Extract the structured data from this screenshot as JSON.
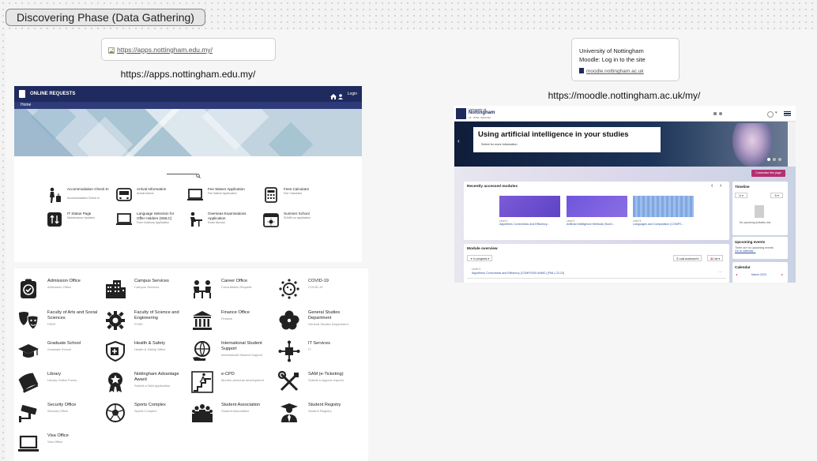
{
  "section": {
    "title": "Discovering Phase (Data Gathering)"
  },
  "left_link": {
    "url_text": "https://apps.nottingham.edu.my/",
    "caption": "https://apps.nottingham.edu.my/"
  },
  "right_link": {
    "title_line1": "University of Nottingham",
    "title_line2": "Moodle: Log in to the site",
    "domain": "moodle.nottingham.ac.uk",
    "caption": "https://moodle.nottingham.ac.uk/my/"
  },
  "online_requests": {
    "header": "ONLINE REQUESTS",
    "login": "Login",
    "nav_home": "Home",
    "tiles": [
      {
        "title": "Accommodation Check-In",
        "sub": "Accommodation Check In"
      },
      {
        "title": "Arrival Information",
        "sub": "Arrival Advice"
      },
      {
        "title": "Fee Waiver Application",
        "sub": "Fee Waiver Application"
      },
      {
        "title": "Fees Calculator",
        "sub": "Fee Calculator"
      },
      {
        "title": "IT Status Page",
        "sub": "Maintenance Updates"
      },
      {
        "title": "Language Selection for Offer Holders (SMLC)",
        "sub": "Form Advisory Application"
      },
      {
        "title": "Overseas Examinations Application",
        "sub": "Exam Abroad"
      },
      {
        "title": "Summer School",
        "sub": "SUMM on application"
      }
    ]
  },
  "directory": {
    "items": [
      {
        "title": "Admission Office",
        "sub": "Admission Office",
        "icon": "clipboard-check-icon"
      },
      {
        "title": "Campus Services",
        "sub": "Campus Services",
        "icon": "buildings-icon"
      },
      {
        "title": "Career Office",
        "sub": "Consultation Request",
        "icon": "meeting-icon"
      },
      {
        "title": "COVID-19",
        "sub": "COVID-19",
        "icon": "virus-icon"
      },
      {
        "title": "Faculty of Arts and Social Sciences",
        "sub": "FASS",
        "icon": "theater-masks-icon"
      },
      {
        "title": "Faculty of Science and Engineering",
        "sub": "FOSE",
        "icon": "gear-icon"
      },
      {
        "title": "Finance Office",
        "sub": "Finance",
        "icon": "bank-icon"
      },
      {
        "title": "General Studies Department",
        "sub": "General Studies Department",
        "icon": "flower-icon"
      },
      {
        "title": "Graduate School",
        "sub": "Graduate School",
        "icon": "graduation-cap-icon"
      },
      {
        "title": "Health & Safety",
        "sub": "Health & Safety Office",
        "icon": "medical-shield-icon"
      },
      {
        "title": "International Student Support",
        "sub": "International Student Support",
        "icon": "globe-hand-icon"
      },
      {
        "title": "IT Services",
        "sub": "IT",
        "icon": "network-icon"
      },
      {
        "title": "Library",
        "sub": "Library Online Forms",
        "icon": "book-icon"
      },
      {
        "title": "Nottingham Advantage Award",
        "sub": "Submit a NAA application",
        "icon": "award-icon"
      },
      {
        "title": "e-CPD",
        "sub": "Monitor personal development",
        "icon": "stairs-climb-icon"
      },
      {
        "title": "SAM (e-Ticketing)",
        "sub": "Submit a support request",
        "icon": "tools-icon"
      },
      {
        "title": "Security Office",
        "sub": "Security Office",
        "icon": "cctv-icon"
      },
      {
        "title": "Sports Complex",
        "sub": "Sports Complex",
        "icon": "soccer-ball-icon"
      },
      {
        "title": "Student Association",
        "sub": "Student Association",
        "icon": "group-icon"
      },
      {
        "title": "Student Registry",
        "sub": "Student Registry",
        "icon": "graduate-person-icon"
      },
      {
        "title": "Visa Office",
        "sub": "Visa Office",
        "icon": "laptop-icon"
      }
    ]
  },
  "moodle": {
    "logo_line1": "University of",
    "logo_line2": "Nottingham",
    "logo_line3": "UK · CHINA · MALAYSIA",
    "hero_title": "Using artificial intelligence in your studies",
    "hero_sub": "Select for more information",
    "customise": "Customise this page",
    "recent_title": "Recently accessed modules",
    "modules": [
      {
        "level": "Level 3",
        "name": "Algorithms Correctness and Efficiency..."
      },
      {
        "level": "Level 3",
        "name": "Artificial Intelligence Methods (Sum2..."
      },
      {
        "level": "Level 3",
        "name": "Languages and Computation (COMP2..."
      }
    ],
    "overview_title": "Module overview",
    "filter_label": "In progress",
    "sort_label": "Last accessed",
    "view_label": "List",
    "overview_level": "Level 3",
    "overview_item": "Algorithms Correctness and Efficiency (COMP2039 UNMC) (FML1 22-23)",
    "timeline_title": "Timeline",
    "timeline_empty": "No upcoming activities due",
    "events_title": "Upcoming events",
    "events_text": "There are no upcoming events",
    "events_link": "Go to calendar...",
    "calendar_title": "Calendar",
    "calendar_month": "March 2023"
  }
}
